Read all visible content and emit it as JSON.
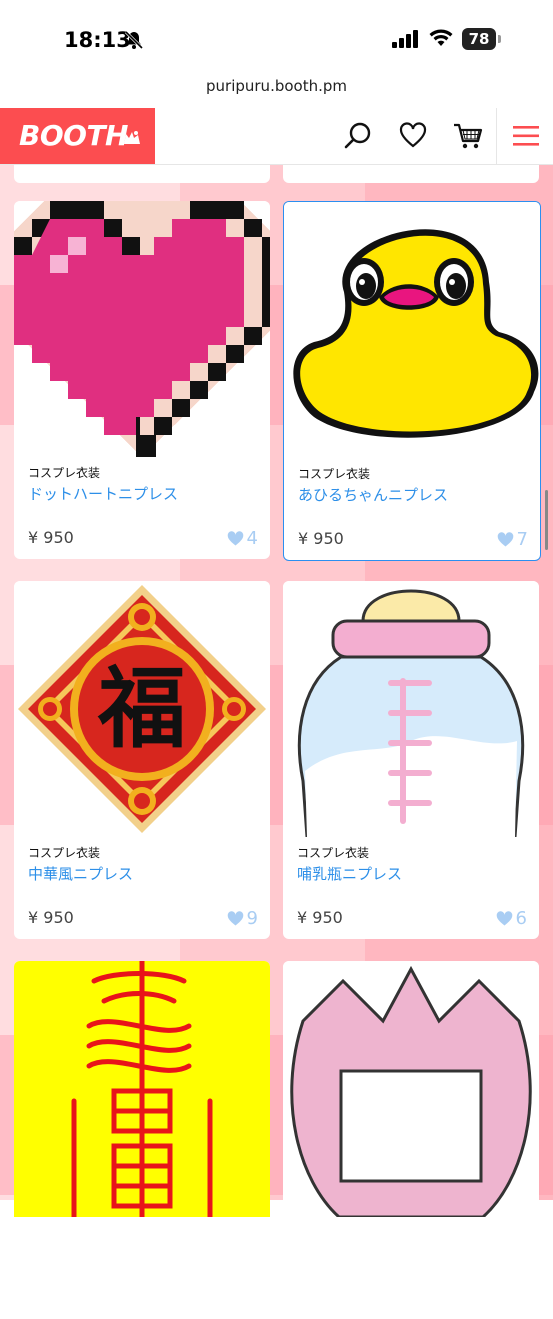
{
  "status_bar": {
    "time": "18:13",
    "battery": "78"
  },
  "browser": {
    "url": "puripuru.booth.pm"
  },
  "header": {
    "logo": "BOOTH"
  },
  "products": [
    {
      "category": "コスプレ衣装",
      "title": "ドットハートニプレス",
      "price": "¥ 950",
      "likes": "4",
      "image": "pixel-heart"
    },
    {
      "category": "コスプレ衣装",
      "title": "あひるちゃんニプレス",
      "price": "¥ 950",
      "likes": "7",
      "image": "yellow-duck"
    },
    {
      "category": "コスプレ衣装",
      "title": "中華風ニプレス",
      "price": "¥ 950",
      "likes": "9",
      "image": "fu-charm"
    },
    {
      "category": "コスプレ衣装",
      "title": "哺乳瓶ニプレス",
      "price": "¥ 950",
      "likes": "6",
      "image": "baby-bottle"
    },
    {
      "category": "",
      "title": "",
      "price": "",
      "likes": "",
      "image": "talisman"
    },
    {
      "category": "",
      "title": "",
      "price": "",
      "likes": "",
      "image": "pink-crown"
    }
  ],
  "colors": {
    "brand": "#fc4d50",
    "link": "#2d8fe8",
    "like": "#a9cdf3",
    "selected_border": "#2b8ff0",
    "background": "#ffc9cf"
  }
}
